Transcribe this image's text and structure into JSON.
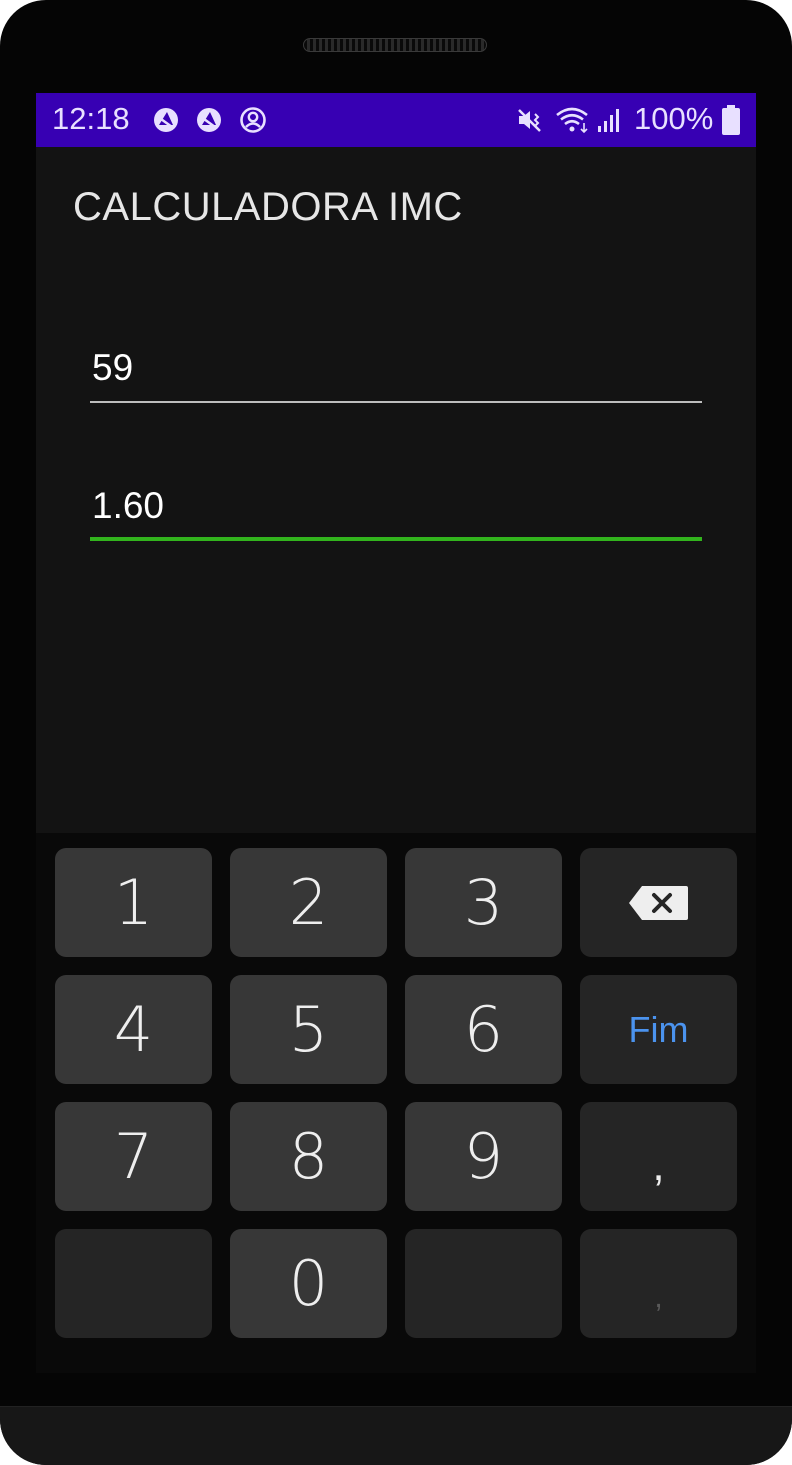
{
  "statusbar": {
    "time": "12:18",
    "battery_pct": "100%",
    "left_icons": [
      "notification-app-icon",
      "notification-app-icon",
      "account-circle-icon"
    ],
    "right_icons": [
      "vibrate-icon",
      "wifi-icon",
      "signal-icon",
      "battery-icon"
    ],
    "bg_color": "#3700b3"
  },
  "app": {
    "title": "CALCULADORA IMC"
  },
  "form": {
    "weight_value": "59",
    "height_value": "1.60",
    "focus_color": "#32b41d"
  },
  "keyboard": {
    "keys": [
      "1",
      "2",
      "3",
      "4",
      "5",
      "6",
      "7",
      "8",
      "9",
      "0"
    ],
    "done_label": "Fim",
    "comma_label": ",",
    "comma2_label": ",",
    "done_color": "#4b93ee"
  }
}
